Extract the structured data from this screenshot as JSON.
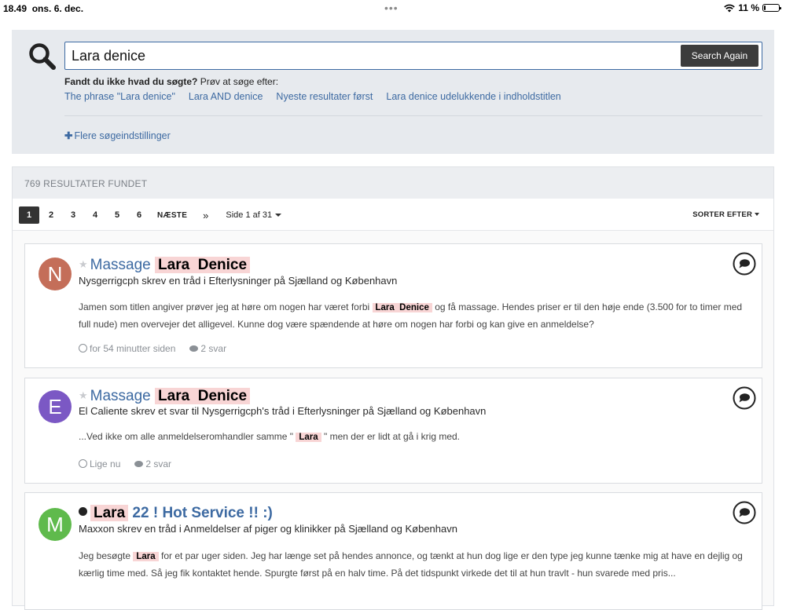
{
  "status_bar": {
    "time": "18.49",
    "date": "ons. 6. dec.",
    "dots": "•••",
    "battery": "11 %",
    "battery_level": 0.11
  },
  "search": {
    "icon": "search-icon",
    "query": "Lara denice",
    "button_label": "Search Again",
    "suggestion_prompt_bold": "Fandt du ikke hvad du søgte?",
    "suggestion_prompt_rest": " Prøv at søge efter:",
    "suggestions": [
      "The phrase \"Lara denice\"",
      "Lara AND denice",
      "Nyeste resultater først",
      "Lara denice udelukkende i indholdstitlen"
    ],
    "more_options_icon": "plus-icon",
    "more_options": "Flere søgeindstillinger"
  },
  "results": {
    "count_label": "769 RESULTATER FUNDET",
    "pagination": {
      "pages": [
        "1",
        "2",
        "3",
        "4",
        "5",
        "6"
      ],
      "active_page": "1",
      "next_label": "NÆSTE",
      "last_label": "»",
      "page_of": "Side 1 af 31"
    },
    "sort_label": "SORTER EFTER",
    "items": [
      {
        "avatar_letter": "N",
        "avatar_color": "#c46e59",
        "title_prefix": "Massage",
        "title_highlight": "Lara  Denice",
        "title_suffix": "",
        "subtitle": "Nysgerrigcph skrev en tråd i Efterlysninger på Sjælland og København",
        "body_before": "Jamen som titlen angiver prøver jeg at høre om nogen har været forbi ",
        "body_highlight": "Lara  Denice",
        "body_after": " og få massage. Hendes priser er til den høje ende (3.500 for to timer med full nude) men overvejer det alligevel. Kunne dog være spændende at høre om nogen har forbi og kan give en anmeldelse?",
        "time": "for 54 minutter siden",
        "replies": "2 svar"
      },
      {
        "avatar_letter": "E",
        "avatar_color": "#7b58c4",
        "title_prefix": "Massage",
        "title_highlight": "Lara  Denice",
        "title_suffix": "",
        "subtitle": "El Caliente skrev et svar til Nysgerrigcph's tråd i Efterlysninger på Sjælland og København",
        "body_before": "...Ved ikke om alle anmeldelseromhandler samme \" ",
        "body_highlight": "Lara",
        "body_after": " \" men der er lidt at gå i krig med.",
        "time": "Lige nu",
        "replies": "2 svar"
      },
      {
        "avatar_letter": "M",
        "avatar_color": "#5fba4c",
        "title_prefix": "",
        "title_highlight": "Lara",
        "title_suffix": " 22 ! Hot Service !! :)",
        "subtitle": "Maxxon skrev en tråd i Anmeldelser af piger og klinikker på Sjælland og København",
        "body_before": "Jeg besøgte ",
        "body_highlight": "Lara",
        "body_after": " for et par uger siden. Jeg har længe set på hendes annonce, og tænkt at hun dog lige er den type jeg kunne tænke mig at have en dejlig og kærlig time med. Så jeg fik kontaktet hende. Spurgte først på en halv time. På det tidspunkt virkede det til at hun travlt - hun svarede med pris...",
        "time": "",
        "replies": ""
      }
    ]
  }
}
